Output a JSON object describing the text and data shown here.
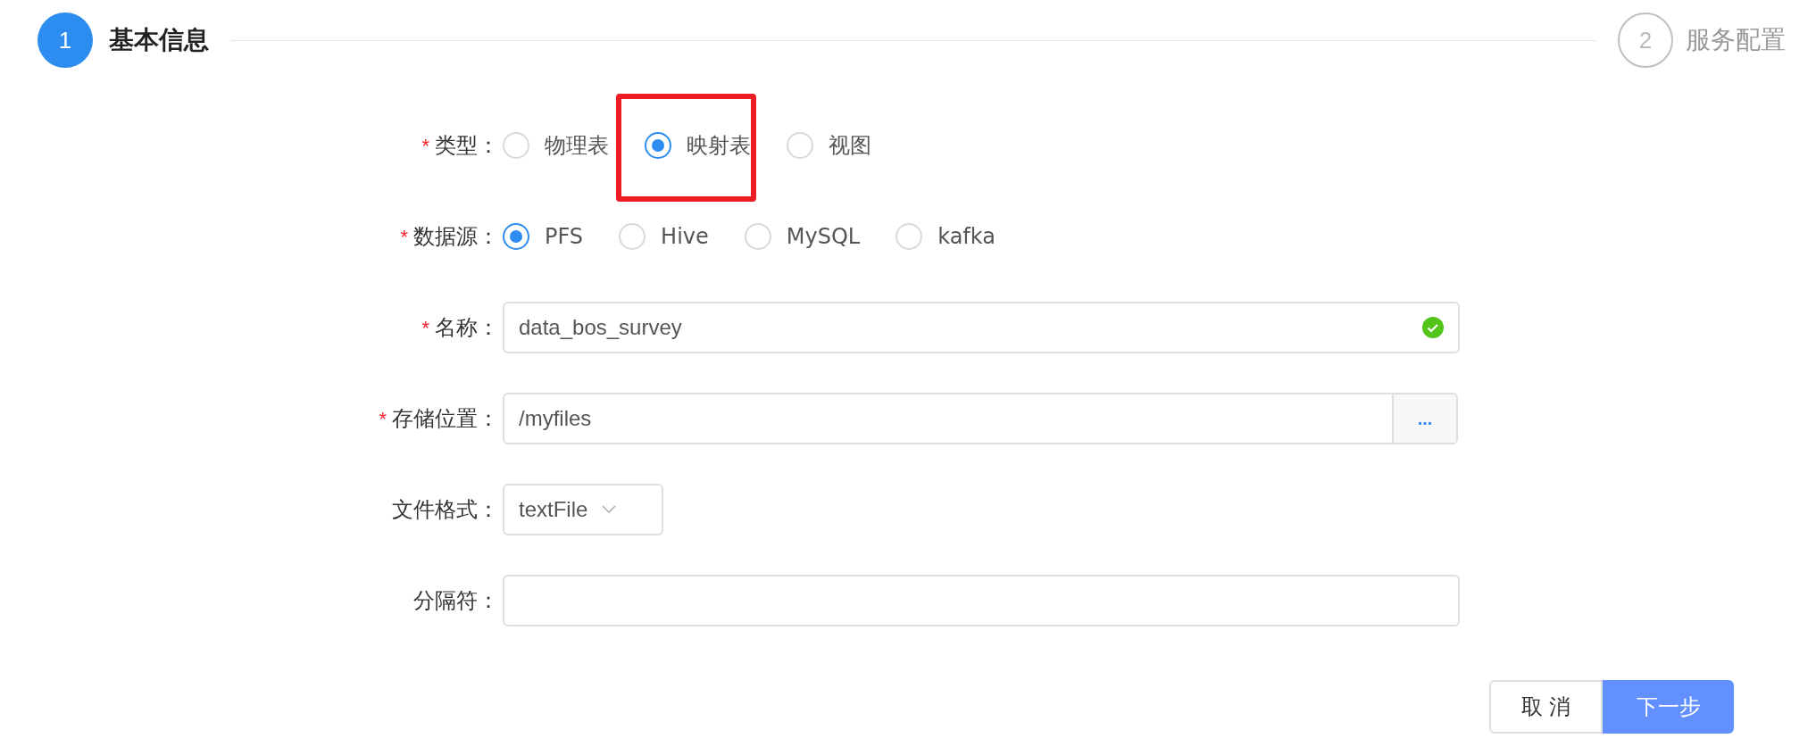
{
  "steps": [
    {
      "number": "1",
      "title": "基本信息",
      "selected": true
    },
    {
      "number": "2",
      "title": "服务配置",
      "selected": false
    }
  ],
  "form": {
    "fields": [
      {
        "kind": "radio",
        "required_mark": "*",
        "label": "类型：",
        "options": [
          {
            "label": "物理表",
            "selected": false,
            "highlighted": false
          },
          {
            "label": "映射表",
            "selected": true,
            "highlighted": true
          },
          {
            "label": "视图",
            "selected": false,
            "highlighted": false
          }
        ]
      },
      {
        "kind": "radio",
        "required_mark": "*",
        "label": "数据源：",
        "options": [
          {
            "label": "PFS",
            "selected": true,
            "highlighted": false
          },
          {
            "label": "Hive",
            "selected": false,
            "highlighted": false
          },
          {
            "label": "MySQL",
            "selected": false,
            "highlighted": false
          },
          {
            "label": "kafka",
            "selected": false,
            "highlighted": false
          }
        ]
      },
      {
        "kind": "text",
        "required_mark": "*",
        "label": "名称：",
        "value": "data_bos_survey",
        "valid": true
      },
      {
        "kind": "browse",
        "required_mark": "*",
        "label": "存储位置：",
        "value": "/myfiles",
        "button": "..."
      },
      {
        "kind": "select",
        "label": "文件格式：",
        "value": "textFile"
      },
      {
        "kind": "text",
        "label": "分隔符："
      }
    ]
  },
  "buttons": {
    "cancel": "取 消",
    "next": "下一步"
  }
}
